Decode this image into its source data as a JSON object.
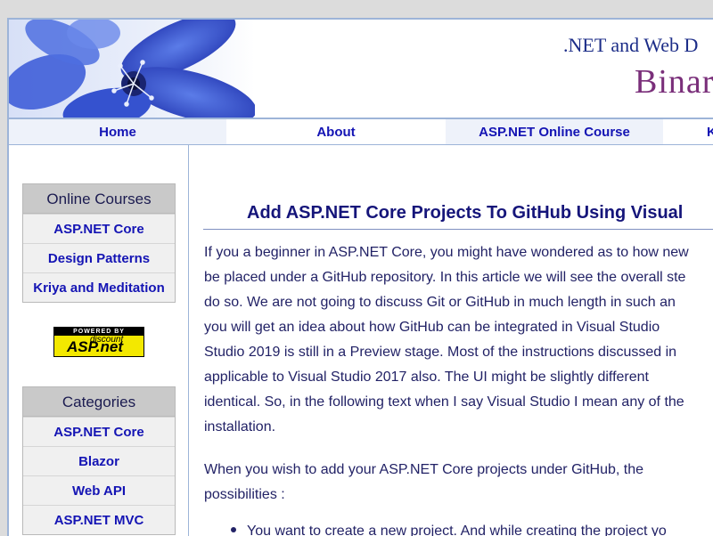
{
  "header": {
    "tagline": ".NET and Web D",
    "brand": "Binar"
  },
  "nav": {
    "items": [
      {
        "label": "Home"
      },
      {
        "label": "About"
      },
      {
        "label": "ASP.NET Online Course"
      },
      {
        "label": "K"
      }
    ]
  },
  "sidebar": {
    "online_courses": {
      "title": "Online Courses",
      "links": [
        "ASP.NET Core",
        "Design Patterns",
        "Kriya and Meditation"
      ]
    },
    "badge": {
      "top": "POWERED BY",
      "line1": "discount",
      "line2": "ASP.net"
    },
    "categories": {
      "title": "Categories",
      "links": [
        "ASP.NET Core",
        "Blazor",
        "Web API",
        "ASP.NET MVC"
      ]
    }
  },
  "article": {
    "title": "Add ASP.NET Core Projects To GitHub Using Visual",
    "p1": [
      "If you a beginner in ASP.NET Core, you might have wondered as to how  new",
      "be placed under a GitHub repository. In this article we will see the overall ste",
      "do so. We are not going to discuss Git or GitHub in much length in such an",
      "you will get an idea about how GitHub can be integrated in Visual Studio",
      "Studio 2019 is still in a Preview stage. Most of the instructions discussed in",
      "applicable to Visual Studio 2017 also. The UI might be slightly different",
      "identical. So, in the following text when I say Visual Studio I mean any of the",
      "installation."
    ],
    "p2": [
      "When you wish to add your ASP.NET Core projects under GitHub, the",
      "possibilities :"
    ],
    "bullet1": "You want to create a new project. And while creating the project yo"
  }
}
